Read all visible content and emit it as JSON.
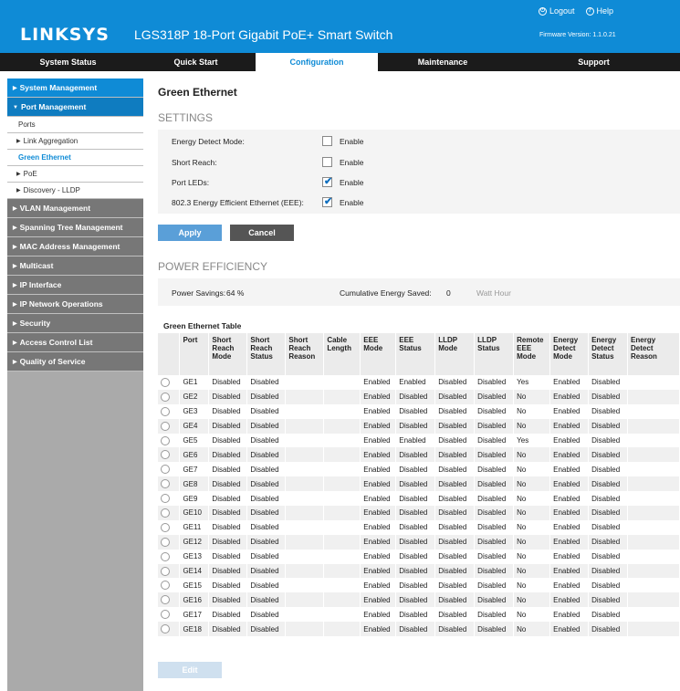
{
  "header": {
    "logo": "LINKSYS",
    "product": "LGS318P 18-Port Gigabit PoE+ Smart Switch",
    "logout": "Logout",
    "help": "Help",
    "firmware": "Firmware Version: 1.1.0.21"
  },
  "nav": {
    "tabs": [
      "System Status",
      "Quick Start",
      "Configuration",
      "Maintenance",
      "Support"
    ],
    "active": "Configuration"
  },
  "sidebar": {
    "items": [
      {
        "label": "System Management"
      },
      {
        "label": "Port Management"
      },
      {
        "label": "Ports"
      },
      {
        "label": "Link Aggregation"
      },
      {
        "label": "Green Ethernet"
      },
      {
        "label": "PoE"
      },
      {
        "label": "Discovery - LLDP"
      },
      {
        "label": "VLAN Management"
      },
      {
        "label": "Spanning Tree Management"
      },
      {
        "label": "MAC Address Management"
      },
      {
        "label": "Multicast"
      },
      {
        "label": "IP Interface"
      },
      {
        "label": "IP Network Operations"
      },
      {
        "label": "Security"
      },
      {
        "label": "Access Control List"
      },
      {
        "label": "Quality of Service"
      }
    ]
  },
  "page": {
    "title": "Green Ethernet",
    "settings_heading": "SETTINGS",
    "settings": [
      {
        "label": "Energy Detect Mode:",
        "checked": false,
        "option": "Enable"
      },
      {
        "label": "Short Reach:",
        "checked": false,
        "option": "Enable"
      },
      {
        "label": "Port LEDs:",
        "checked": true,
        "option": "Enable"
      },
      {
        "label": "802.3 Energy Efficient Ethernet (EEE):",
        "checked": true,
        "option": "Enable"
      }
    ],
    "apply": "Apply",
    "cancel": "Cancel",
    "power_heading": "POWER EFFICIENCY",
    "power_savings_label": "Power Savings:",
    "power_savings_value": "64 %",
    "cumulative_label": "Cumulative Energy Saved:",
    "cumulative_value": "0",
    "cumulative_unit": "Watt Hour",
    "edit": "Edit"
  },
  "table": {
    "title": "Green Ethernet Table",
    "headers": [
      "",
      "Port",
      "Short Reach Mode",
      "Short Reach Status",
      "Short Reach Reason",
      "Cable Length",
      "EEE Mode",
      "EEE Status",
      "LLDP Mode",
      "LLDP Status",
      "Remote EEE Mode",
      "Energy Detect Mode",
      "Energy Detect Status",
      "Energy Detect Reason"
    ],
    "rows": [
      [
        "GE1",
        "Disabled",
        "Disabled",
        "",
        "",
        "Enabled",
        "Enabled",
        "Disabled",
        "Disabled",
        "Yes",
        "Enabled",
        "Disabled",
        ""
      ],
      [
        "GE2",
        "Disabled",
        "Disabled",
        "",
        "",
        "Enabled",
        "Disabled",
        "Disabled",
        "Disabled",
        "No",
        "Enabled",
        "Disabled",
        ""
      ],
      [
        "GE3",
        "Disabled",
        "Disabled",
        "",
        "",
        "Enabled",
        "Disabled",
        "Disabled",
        "Disabled",
        "No",
        "Enabled",
        "Disabled",
        ""
      ],
      [
        "GE4",
        "Disabled",
        "Disabled",
        "",
        "",
        "Enabled",
        "Disabled",
        "Disabled",
        "Disabled",
        "No",
        "Enabled",
        "Disabled",
        ""
      ],
      [
        "GE5",
        "Disabled",
        "Disabled",
        "",
        "",
        "Enabled",
        "Enabled",
        "Disabled",
        "Disabled",
        "Yes",
        "Enabled",
        "Disabled",
        ""
      ],
      [
        "GE6",
        "Disabled",
        "Disabled",
        "",
        "",
        "Enabled",
        "Disabled",
        "Disabled",
        "Disabled",
        "No",
        "Enabled",
        "Disabled",
        ""
      ],
      [
        "GE7",
        "Disabled",
        "Disabled",
        "",
        "",
        "Enabled",
        "Disabled",
        "Disabled",
        "Disabled",
        "No",
        "Enabled",
        "Disabled",
        ""
      ],
      [
        "GE8",
        "Disabled",
        "Disabled",
        "",
        "",
        "Enabled",
        "Disabled",
        "Disabled",
        "Disabled",
        "No",
        "Enabled",
        "Disabled",
        ""
      ],
      [
        "GE9",
        "Disabled",
        "Disabled",
        "",
        "",
        "Enabled",
        "Disabled",
        "Disabled",
        "Disabled",
        "No",
        "Enabled",
        "Disabled",
        ""
      ],
      [
        "GE10",
        "Disabled",
        "Disabled",
        "",
        "",
        "Enabled",
        "Disabled",
        "Disabled",
        "Disabled",
        "No",
        "Enabled",
        "Disabled",
        ""
      ],
      [
        "GE11",
        "Disabled",
        "Disabled",
        "",
        "",
        "Enabled",
        "Disabled",
        "Disabled",
        "Disabled",
        "No",
        "Enabled",
        "Disabled",
        ""
      ],
      [
        "GE12",
        "Disabled",
        "Disabled",
        "",
        "",
        "Enabled",
        "Disabled",
        "Disabled",
        "Disabled",
        "No",
        "Enabled",
        "Disabled",
        ""
      ],
      [
        "GE13",
        "Disabled",
        "Disabled",
        "",
        "",
        "Enabled",
        "Disabled",
        "Disabled",
        "Disabled",
        "No",
        "Enabled",
        "Disabled",
        ""
      ],
      [
        "GE14",
        "Disabled",
        "Disabled",
        "",
        "",
        "Enabled",
        "Disabled",
        "Disabled",
        "Disabled",
        "No",
        "Enabled",
        "Disabled",
        ""
      ],
      [
        "GE15",
        "Disabled",
        "Disabled",
        "",
        "",
        "Enabled",
        "Disabled",
        "Disabled",
        "Disabled",
        "No",
        "Enabled",
        "Disabled",
        ""
      ],
      [
        "GE16",
        "Disabled",
        "Disabled",
        "",
        "",
        "Enabled",
        "Disabled",
        "Disabled",
        "Disabled",
        "No",
        "Enabled",
        "Disabled",
        ""
      ],
      [
        "GE17",
        "Disabled",
        "Disabled",
        "",
        "",
        "Enabled",
        "Disabled",
        "Disabled",
        "Disabled",
        "No",
        "Enabled",
        "Disabled",
        ""
      ],
      [
        "GE18",
        "Disabled",
        "Disabled",
        "",
        "",
        "Enabled",
        "Disabled",
        "Disabled",
        "Disabled",
        "No",
        "Enabled",
        "Disabled",
        ""
      ]
    ]
  },
  "colors": {
    "brand_blue": "#0f8bd6",
    "nav_bg": "#1b1b1b",
    "sidebar_gray": "#777777",
    "check_blue": "#0f6fbf"
  }
}
